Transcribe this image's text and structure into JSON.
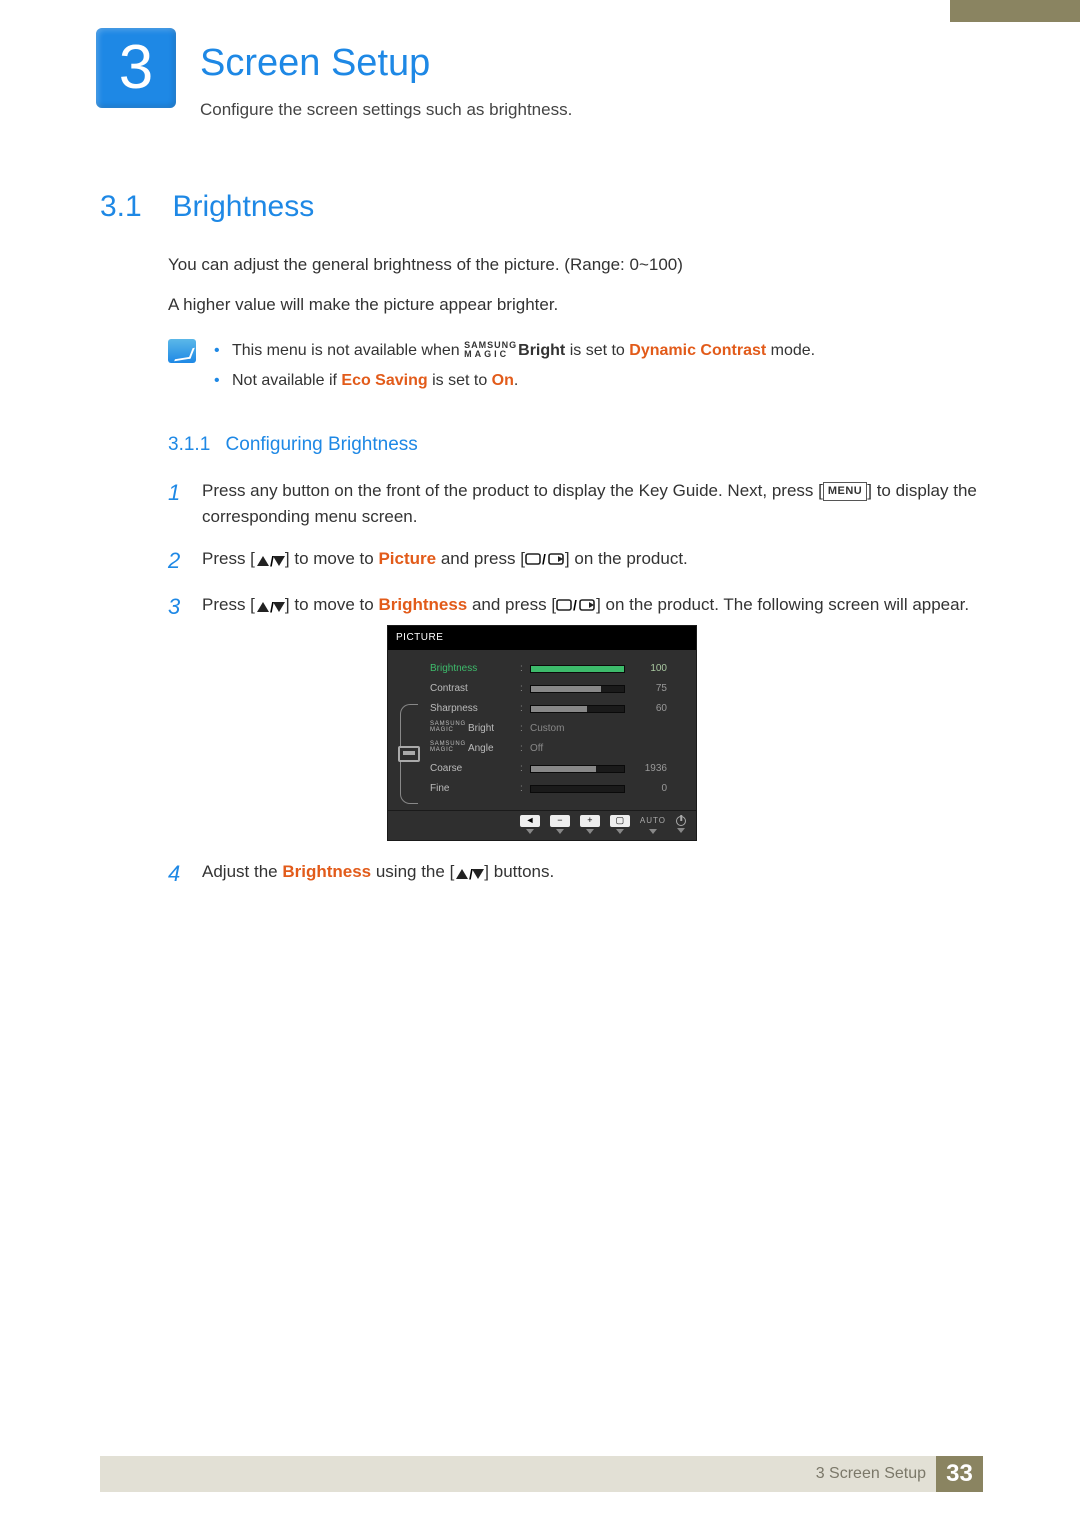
{
  "chapter": {
    "number": "3",
    "title": "Screen Setup",
    "description": "Configure the screen settings such as brightness."
  },
  "section": {
    "number": "3.1",
    "title": "Brightness",
    "para1": "You can adjust the general brightness of the picture. (Range: 0~100)",
    "para2": "A higher value will make the picture appear brighter."
  },
  "notes": {
    "item1_pre": "This menu is not available when ",
    "item1_brand_top": "SAMSUNG",
    "item1_brand_bot": "MAGIC",
    "item1_bright": "Bright",
    "item1_mid": " is set to ",
    "item1_hl": "Dynamic Contrast",
    "item1_post": " mode.",
    "item2_pre": "Not available if ",
    "item2_hl1": "Eco Saving",
    "item2_mid": " is set to ",
    "item2_hl2": "On",
    "item2_post": "."
  },
  "subsection": {
    "number": "3.1.1",
    "title": "Configuring Brightness"
  },
  "steps": {
    "s1": {
      "n": "1",
      "pre": "Press any button on the front of the product to display the Key Guide. Next, press [",
      "menu": "MENU",
      "post": "] to display the corresponding menu screen."
    },
    "s2": {
      "n": "2",
      "pre": "Press [",
      "mid1": "] to move to ",
      "hl": "Picture",
      "mid2": " and press [",
      "post": "] on the product."
    },
    "s3": {
      "n": "3",
      "pre": "Press [",
      "mid1": "] to move to ",
      "hl": "Brightness",
      "mid2": " and press [",
      "post": "] on the product. The following screen will appear."
    },
    "s4": {
      "n": "4",
      "pre": "Adjust the ",
      "hl": "Brightness",
      "mid": " using the [",
      "post": "] buttons."
    }
  },
  "osd": {
    "header": "PICTURE",
    "rows": [
      {
        "label": "Brightness",
        "value": "100",
        "fill": 100,
        "active": true
      },
      {
        "label": "Contrast",
        "value": "75",
        "fill": 75,
        "active": false
      },
      {
        "label": "Sharpness",
        "value": "60",
        "fill": 60,
        "active": false
      },
      {
        "label_prefix": "MAGIC",
        "label": "Bright",
        "text": "Custom"
      },
      {
        "label_prefix": "MAGIC",
        "label": "Angle",
        "text": "Off"
      },
      {
        "label": "Coarse",
        "value": "1936",
        "fill": 70,
        "active": false
      },
      {
        "label": "Fine",
        "value": "0",
        "fill": 0,
        "active": false
      }
    ],
    "auto": "AUTO"
  },
  "footer": {
    "text": "3 Screen Setup",
    "page": "33"
  }
}
